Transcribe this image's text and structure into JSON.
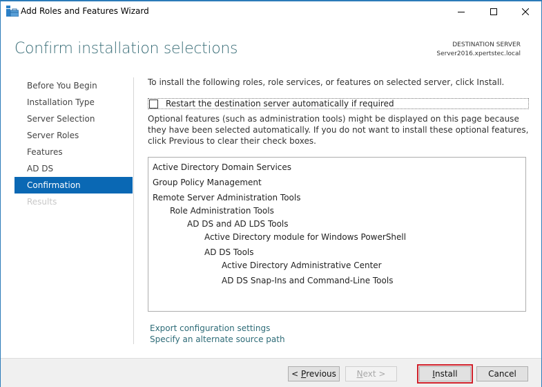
{
  "window": {
    "title": "Add Roles and Features Wizard",
    "icon": "server-manager-icon",
    "controls": [
      "minimize-icon",
      "maximize-icon",
      "close-icon"
    ],
    "accent_color": "#2b7bb9"
  },
  "header": {
    "title": "Confirm installation selections",
    "destination_label": "DESTINATION SERVER",
    "destination_server": "Server2016.xpertstec.local"
  },
  "nav": {
    "items": [
      {
        "label": "Before You Begin",
        "state": "normal"
      },
      {
        "label": "Installation Type",
        "state": "normal"
      },
      {
        "label": "Server Selection",
        "state": "normal"
      },
      {
        "label": "Server Roles",
        "state": "normal"
      },
      {
        "label": "Features",
        "state": "normal"
      },
      {
        "label": "AD DS",
        "state": "normal"
      },
      {
        "label": "Confirmation",
        "state": "active"
      },
      {
        "label": "Results",
        "state": "disabled"
      }
    ],
    "active_color": "#0a68b4"
  },
  "content": {
    "intro": "To install the following roles, role services, or features on selected server, click Install.",
    "restart_checkbox": {
      "label": "Restart the destination server automatically if required",
      "checked": false
    },
    "optional_text": "Optional features (such as administration tools) might be displayed on this page because they have been selected automatically. If you do not want to install these optional features, click Previous to clear their check boxes.",
    "selections": [
      {
        "label": "Active Directory Domain Services",
        "level": 0
      },
      {
        "label": "Group Policy Management",
        "level": 0
      },
      {
        "label": "Remote Server Administration Tools",
        "level": 0
      },
      {
        "label": "Role Administration Tools",
        "level": 1
      },
      {
        "label": "AD DS and AD LDS Tools",
        "level": 2
      },
      {
        "label": "Active Directory module for Windows PowerShell",
        "level": 3
      },
      {
        "label": "AD DS Tools",
        "level": 3
      },
      {
        "label": "Active Directory Administrative Center",
        "level": 4
      },
      {
        "label": "AD DS Snap-Ins and Command-Line Tools",
        "level": 4
      }
    ],
    "links": {
      "export": "Export configuration settings",
      "alternate_source": "Specify an alternate source path"
    }
  },
  "footer": {
    "previous": {
      "prefix": "< ",
      "mnemonic": "P",
      "rest": "revious",
      "enabled": true
    },
    "next": {
      "mnemonic": "N",
      "rest": "ext >",
      "enabled": false
    },
    "install": {
      "mnemonic": "I",
      "rest": "nstall",
      "enabled": true,
      "highlight_color": "#d0202a"
    },
    "cancel": {
      "label": "Cancel",
      "enabled": true
    }
  }
}
